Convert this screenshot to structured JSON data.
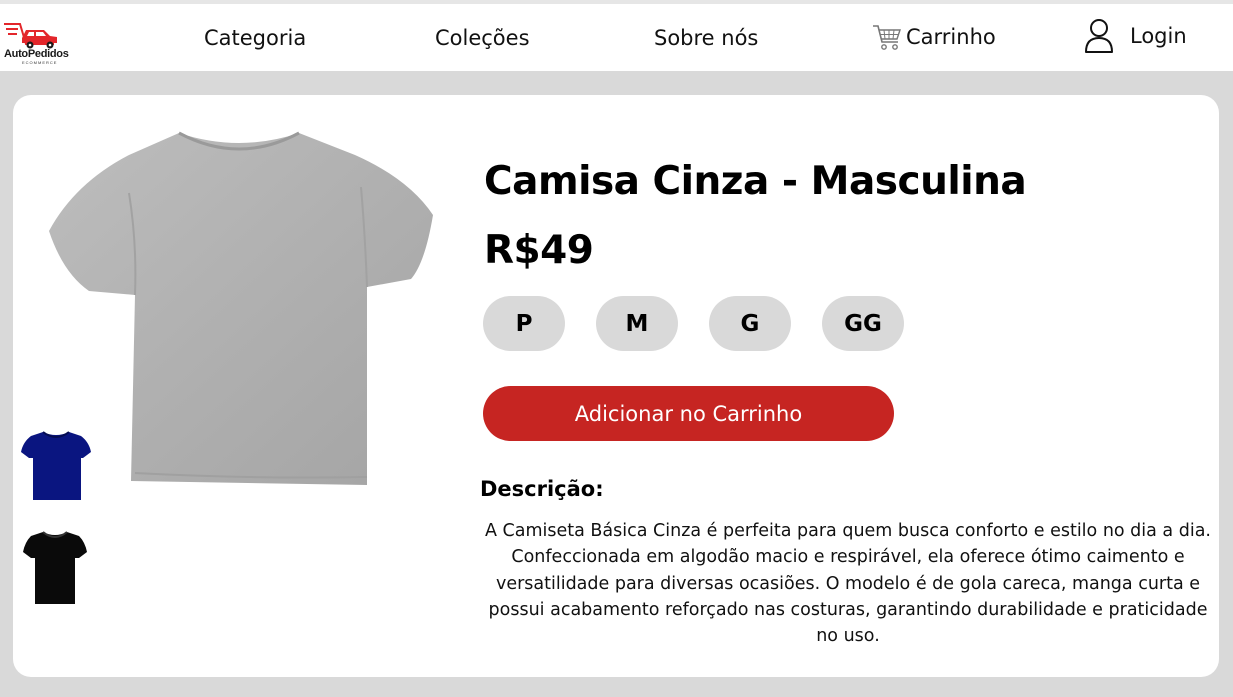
{
  "header": {
    "logo": {
      "name": "AutoPedidos",
      "tagline": "ECOMMERCE",
      "icon": "car-cart-logo",
      "accent": "#e3262b"
    },
    "nav": {
      "categoria": "Categoria",
      "colecoes": "Coleções",
      "sobre": "Sobre nós",
      "carrinho": "Carrinho",
      "login": "Login"
    },
    "icons": {
      "cart": "shopping-cart-icon",
      "user": "user-icon"
    }
  },
  "product": {
    "title": "Camisa Cinza - Masculina",
    "price": "R$49",
    "image_color": "#b3b3b3",
    "variants": [
      {
        "name": "blue-tshirt",
        "color": "#0a1580"
      },
      {
        "name": "black-tshirt",
        "color": "#0a0a0a"
      }
    ],
    "sizes": [
      "P",
      "M",
      "G",
      "GG"
    ],
    "add_to_cart": "Adicionar no Carrinho",
    "description_title": "Descrição:",
    "description": "A Camiseta Básica Cinza é perfeita para quem busca conforto e estilo no dia a dia. Confeccionada em algodão macio e respirável, ela oferece ótimo caimento e versatilidade para diversas ocasiões. O modelo é de gola careca, manga curta e possui acabamento reforçado nas costuras, garantindo durabilidade e praticidade no uso."
  },
  "colors": {
    "page_background": "#d9d9d9",
    "card_background": "#ffffff",
    "size_button": "#d9d9d9",
    "primary_button": "#c62522"
  }
}
